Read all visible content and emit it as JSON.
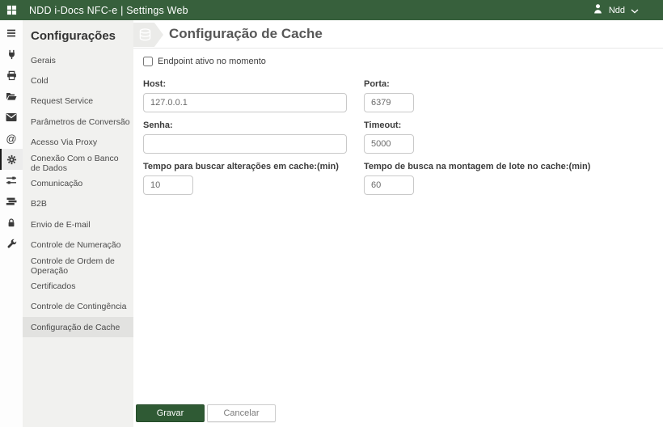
{
  "topbar": {
    "title": "NDD i-Docs NFC-e | Settings Web",
    "user": "Ndd",
    "icons": [
      "apps-grid-icon",
      "user-icon",
      "chevron-down-icon"
    ]
  },
  "icon_sidebar": {
    "items": [
      {
        "icon": "menu-icon",
        "selected": false
      },
      {
        "icon": "plug-icon",
        "selected": false
      },
      {
        "icon": "printer-icon",
        "selected": false
      },
      {
        "icon": "folder-open-icon",
        "selected": false
      },
      {
        "icon": "envelope-icon",
        "selected": false
      },
      {
        "icon": "at-sign-icon",
        "selected": false
      },
      {
        "icon": "gear-icon",
        "selected": true
      },
      {
        "icon": "sliders-icon",
        "selected": false
      },
      {
        "icon": "stacked-bars-icon",
        "selected": false
      },
      {
        "icon": "lock-icon",
        "selected": false
      },
      {
        "icon": "wrench-icon",
        "selected": false
      }
    ]
  },
  "sidebar": {
    "title": "Configurações",
    "items": [
      {
        "label": "Gerais",
        "selected": false
      },
      {
        "label": "Cold",
        "selected": false
      },
      {
        "label": "Request Service",
        "selected": false
      },
      {
        "label": "Parâmetros de Conversão",
        "selected": false
      },
      {
        "label": "Acesso Via Proxy",
        "selected": false
      },
      {
        "label": "Conexão Com o Banco de Dados",
        "selected": false
      },
      {
        "label": "Comunicação",
        "selected": false
      },
      {
        "label": "B2B",
        "selected": false
      },
      {
        "label": "Envio de E-mail",
        "selected": false
      },
      {
        "label": "Controle de Numeração",
        "selected": false
      },
      {
        "label": "Controle de Ordem de Operação",
        "selected": false
      },
      {
        "label": "Certificados",
        "selected": false
      },
      {
        "label": "Controle de Contingência",
        "selected": false
      },
      {
        "label": "Configuração de Cache",
        "selected": true
      }
    ]
  },
  "main": {
    "title": "Configuração de Cache",
    "header_icon": "database-icon",
    "endpoint_checkbox": {
      "label": "Endpoint ativo no momento",
      "checked": false
    },
    "fields": {
      "host": {
        "label": "Host:",
        "value": "127.0.0.1"
      },
      "porta": {
        "label": "Porta:",
        "value": "6379"
      },
      "senha": {
        "label": "Senha:",
        "value": ""
      },
      "timeout": {
        "label": "Timeout:",
        "value": "5000"
      },
      "tempo_alteracoes": {
        "label": "Tempo para buscar alterações em cache:(min)",
        "value": "10"
      },
      "tempo_lote": {
        "label": "Tempo de busca na montagem de lote no cache:(min)",
        "value": "60"
      }
    },
    "actions": {
      "save": "Gravar",
      "cancel": "Cancelar"
    }
  },
  "colors": {
    "topbar_green": "#37603c",
    "button_green": "#2f5a34",
    "sidebar_bg": "#f1f1ef",
    "selected_item_bg": "#e2e2e0",
    "icon_selected_bg": "#ececec"
  }
}
